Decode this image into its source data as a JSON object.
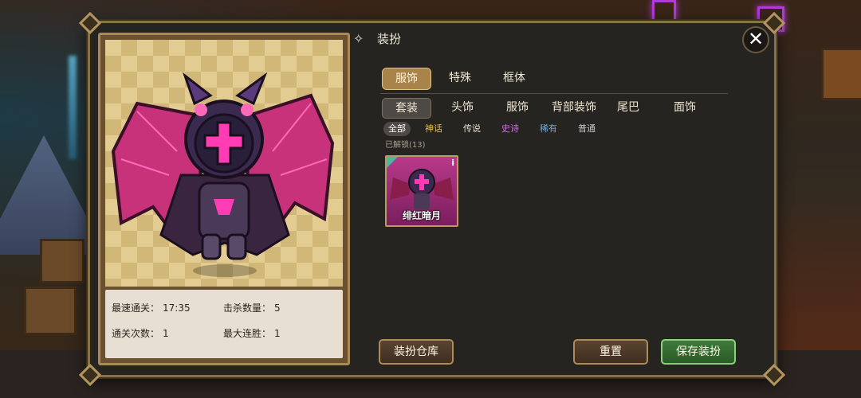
{
  "panel": {
    "title": "装扮",
    "close_symbol": "✕"
  },
  "stats": {
    "fastest_label": "最速通关：",
    "fastest_value": "17:35",
    "kills_label": "击杀数量：",
    "kills_value": "5",
    "clears_label": "通关次数：",
    "clears_value": "1",
    "streak_label": "最大连胜：",
    "streak_value": "1"
  },
  "tabs_primary": [
    {
      "label": "服饰",
      "active": true
    },
    {
      "label": "特殊",
      "active": false
    },
    {
      "label": "框体",
      "active": false
    }
  ],
  "tabs_secondary": [
    {
      "label": "套装",
      "active": true
    },
    {
      "label": "头饰",
      "active": false
    },
    {
      "label": "服饰",
      "active": false
    },
    {
      "label": "背部装饰",
      "active": false
    },
    {
      "label": "尾巴",
      "active": false
    },
    {
      "label": "面饰",
      "active": false
    }
  ],
  "rarity_filters": [
    {
      "label": "全部",
      "color": "#ffffff",
      "active": true
    },
    {
      "label": "神话",
      "color": "#e8c04a"
    },
    {
      "label": "传说",
      "color": "#e6dcc8"
    },
    {
      "label": "史诗",
      "color": "#d070e0"
    },
    {
      "label": "稀有",
      "color": "#70a8d8"
    },
    {
      "label": "普通",
      "color": "#c8c8c8"
    }
  ],
  "unlocked_text": "已解锁(13)",
  "items": [
    {
      "name": "绯红暗月",
      "info_symbol": "i"
    }
  ],
  "buttons": {
    "wardrobe": "装扮仓库",
    "reset": "重置",
    "save": "保存装扮"
  },
  "colors": {
    "accent_gold": "#a8844a",
    "save_green": "#3e7a3a",
    "character_pink": "#ff3cb4",
    "character_dark": "#2a1f3a"
  }
}
